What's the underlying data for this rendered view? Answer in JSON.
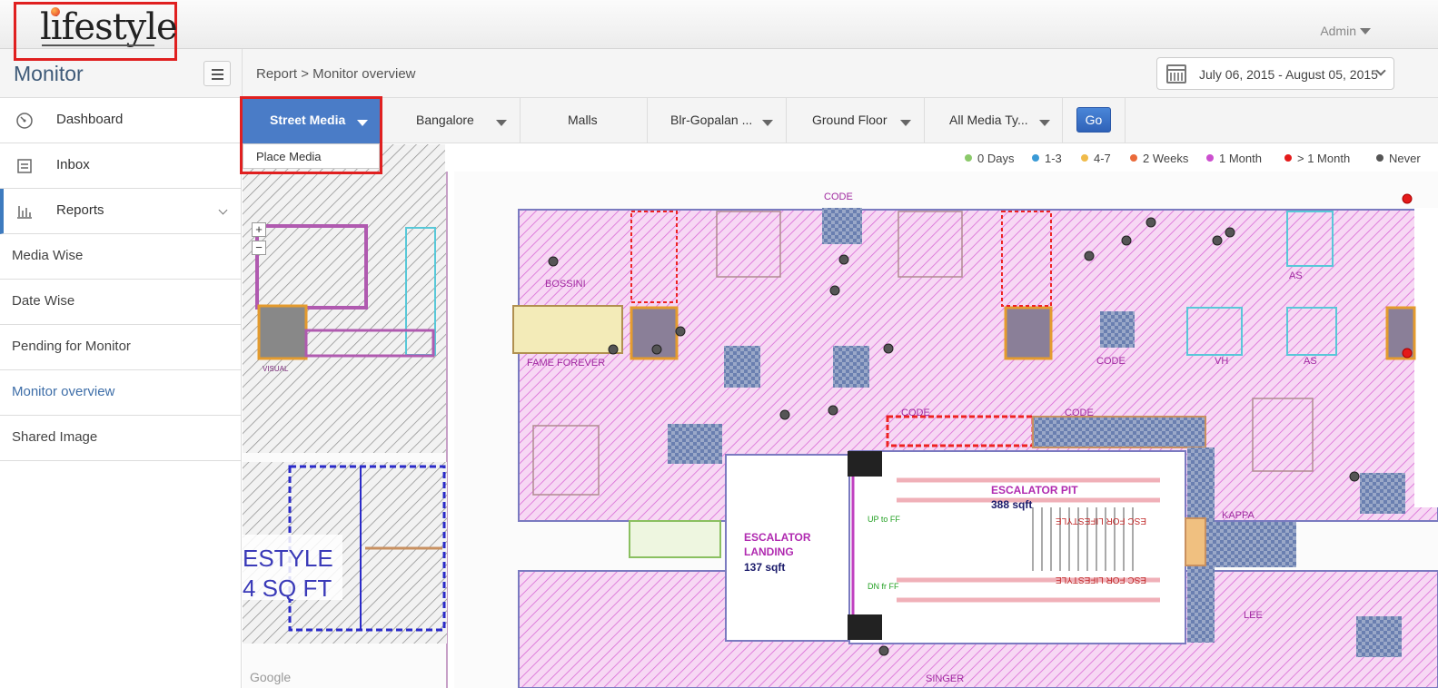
{
  "header": {
    "logo": "lifestyle",
    "user": "Admin"
  },
  "subheader": {
    "module_title": "Monitor",
    "breadcrumb": "Report > Monitor overview",
    "date_range": "July 06, 2015 - August 05, 2015"
  },
  "sidebar": {
    "items": [
      {
        "label": "Dashboard",
        "icon": "gauge-icon"
      },
      {
        "label": "Inbox",
        "icon": "inbox-icon"
      },
      {
        "label": "Reports",
        "icon": "bar-chart-icon"
      }
    ],
    "reports_sub": [
      {
        "label": "Media Wise"
      },
      {
        "label": "Date Wise"
      },
      {
        "label": "Pending for Monitor"
      },
      {
        "label": "Monitor overview"
      },
      {
        "label": "Shared Image"
      }
    ]
  },
  "filters": {
    "media_category": "Street Media",
    "media_category_option": "Place Media",
    "city": "Bangalore",
    "venue_type": "Malls",
    "venue": "Blr-Gopalan ...",
    "floor": "Ground Floor",
    "media_type": "All Media Ty...",
    "go_label": "Go"
  },
  "legend": [
    {
      "label": "0 Days",
      "color": "#8bc96a"
    },
    {
      "label": "1-3",
      "color": "#3a9ad6"
    },
    {
      "label": "4-7",
      "color": "#f0bb4a"
    },
    {
      "label": "2 Weeks",
      "color": "#ea6a3a"
    },
    {
      "label": "1 Month",
      "color": "#cc4fcf"
    },
    {
      "label": "> 1 Month",
      "color": "#e41a1a"
    },
    {
      "label": "Never",
      "color": "#555555"
    }
  ],
  "map": {
    "attribution": "Google",
    "zoom_in": "+",
    "zoom_out": "−",
    "labels": {
      "code_top": "CODE",
      "bossini": "BOSSINI",
      "fame_forever": "FAME FOREVER",
      "visual": "VISUAL",
      "code_mid": "CODE",
      "vh": "VH",
      "as": "AS",
      "code_right": "CODE",
      "code_escalator": "CODE",
      "escalator_landing": "ESCALATOR",
      "escalator_landing2": "LANDING",
      "escalator_landing_sqft": "137 sqft",
      "escalator_pit": "ESCALATOR PIT",
      "escalator_pit_sqft": "388 sqft",
      "esc_for_lifestyle": "ESC FOR LIFESTYLE",
      "up_to_ff": "UP to FF",
      "dn_fr_ff": "DN fr FF",
      "kappa": "KAPPA",
      "lee": "LEE",
      "singer": "SINGER",
      "big_text_1": "ESTYLE",
      "big_text_2": "4 SQ FT"
    }
  }
}
